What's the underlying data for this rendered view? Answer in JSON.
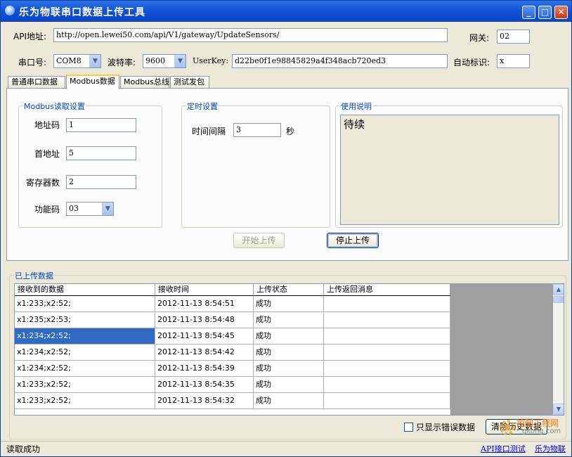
{
  "window": {
    "title": "乐为物联串口数据上传工具",
    "controls": {
      "minimize": "_",
      "maximize": "□",
      "close": "✕"
    }
  },
  "config": {
    "api_label": "API地址:",
    "api_value": "http://open.lewei50.com/api/V1/gateway/UpdateSensors/",
    "gateway_label": "网关:",
    "gateway_value": "02",
    "port_label": "串口号:",
    "port_value": "COM8",
    "baud_label": "波特率:",
    "baud_value": "9600",
    "userkey_label": "UserKey:",
    "userkey_value": "d22be0f1e98845829a4f348acb720ed3",
    "autoid_label": "自动标识:",
    "autoid_value": "x"
  },
  "tabs": [
    {
      "label": "普通串口数据"
    },
    {
      "label": "Modbus数据"
    },
    {
      "label": "Modbus总线"
    },
    {
      "label": "测试发包"
    }
  ],
  "modbus": {
    "group_title": "Modbus读取设置",
    "addr_label": "地址码",
    "addr_value": "1",
    "start_label": "首地址",
    "start_value": "5",
    "regs_label": "寄存器数",
    "regs_value": "2",
    "func_label": "功能码",
    "func_value": "03"
  },
  "timer": {
    "group_title": "定时设置",
    "interval_label": "时间间隔",
    "interval_value": "3",
    "unit": "秒"
  },
  "usage": {
    "group_title": "使用说明",
    "text": "待续"
  },
  "buttons": {
    "start": "开始上传",
    "stop": "停止上传",
    "clear": "清除历史数据"
  },
  "uploaded": {
    "group_title": "已上传数据",
    "columns": [
      "接收到的数据",
      "接收时间",
      "上传状态",
      "上传返回消息"
    ],
    "rows": [
      [
        "x1:233;x2:52;",
        "2012-11-13 8:54:51",
        "成功",
        ""
      ],
      [
        "x1:235;x2:53;",
        "2012-11-13 8:54:48",
        "成功",
        ""
      ],
      [
        "x1:234;x2:52;",
        "2012-11-13 8:54:45",
        "成功",
        ""
      ],
      [
        "x1:234;x2:52;",
        "2012-11-13 8:54:42",
        "成功",
        ""
      ],
      [
        "x1:234;x2:52;",
        "2012-11-13 8:54:39",
        "成功",
        ""
      ],
      [
        "x1:233;x2:52;",
        "2012-11-13 8:54:35",
        "成功",
        ""
      ],
      [
        "x1:233;x2:52;",
        "2012-11-13 8:54:32",
        "成功",
        ""
      ]
    ],
    "selected_row": 2
  },
  "options": {
    "errors_only_label": "只显示错误数据"
  },
  "status": {
    "text": "读取成功",
    "link_api": "API接口测试",
    "link_site": "乐为物联"
  },
  "watermark": {
    "text": "控制工程网",
    "url": "gkong.com"
  },
  "colors": {
    "title_bar": "#1452d6",
    "selection": "#316ac5",
    "group_title": "#0046d5",
    "link": "#0000ff"
  }
}
